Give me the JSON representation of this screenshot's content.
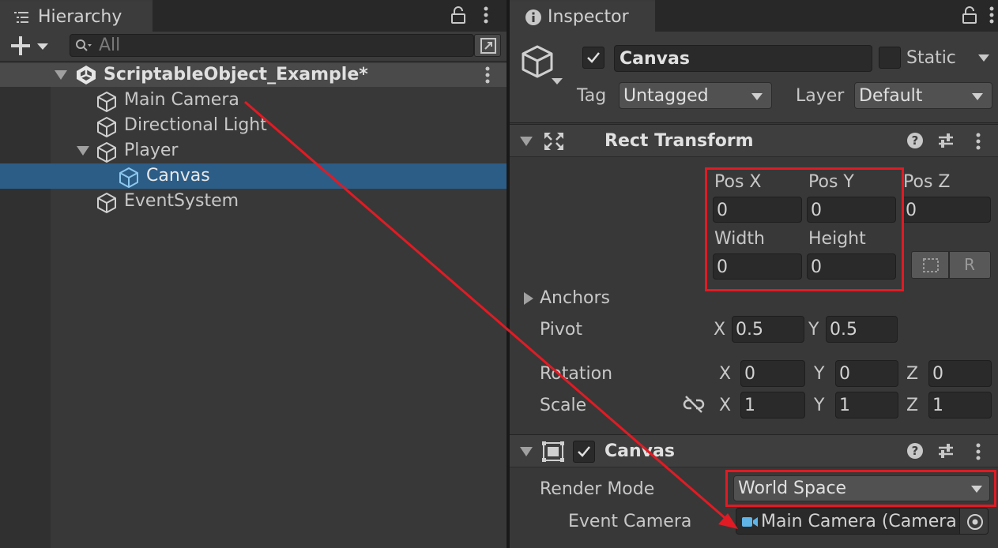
{
  "hierarchy": {
    "tab_title": "Hierarchy",
    "search": {
      "placeholder": "All"
    },
    "scene_name": "ScriptableObject_Example*",
    "items": [
      {
        "label": "Main Camera"
      },
      {
        "label": "Directional Light"
      },
      {
        "label": "Player"
      },
      {
        "label": "Canvas"
      },
      {
        "label": "EventSystem"
      }
    ]
  },
  "inspector": {
    "tab_title": "Inspector",
    "object_name": "Canvas",
    "static_label": "Static",
    "tag_label": "Tag",
    "tag_value": "Untagged",
    "layer_label": "Layer",
    "layer_value": "Default",
    "rect_transform": {
      "title": "Rect Transform",
      "pos_x_label": "Pos X",
      "pos_x": "0",
      "pos_y_label": "Pos Y",
      "pos_y": "0",
      "pos_z_label": "Pos Z",
      "pos_z": "0",
      "width_label": "Width",
      "width": "0",
      "height_label": "Height",
      "height": "0",
      "raw_button": "R",
      "anchors_label": "Anchors",
      "pivot_label": "Pivot",
      "pivot_x": "0.5",
      "pivot_y": "0.5",
      "rotation_label": "Rotation",
      "rot_x": "0",
      "rot_y": "0",
      "rot_z": "0",
      "scale_label": "Scale",
      "scale_x": "1",
      "scale_y": "1",
      "scale_z": "1",
      "x": "X",
      "y": "Y",
      "z": "Z"
    },
    "canvas": {
      "title": "Canvas",
      "render_mode_label": "Render Mode",
      "render_mode_value": "World Space",
      "event_camera_label": "Event Camera",
      "event_camera_value": "Main Camera (Camera"
    }
  },
  "colors": {
    "annotation_red": "#e01b24",
    "selection_blue": "#2c5d87",
    "panel_bg": "#383838"
  }
}
